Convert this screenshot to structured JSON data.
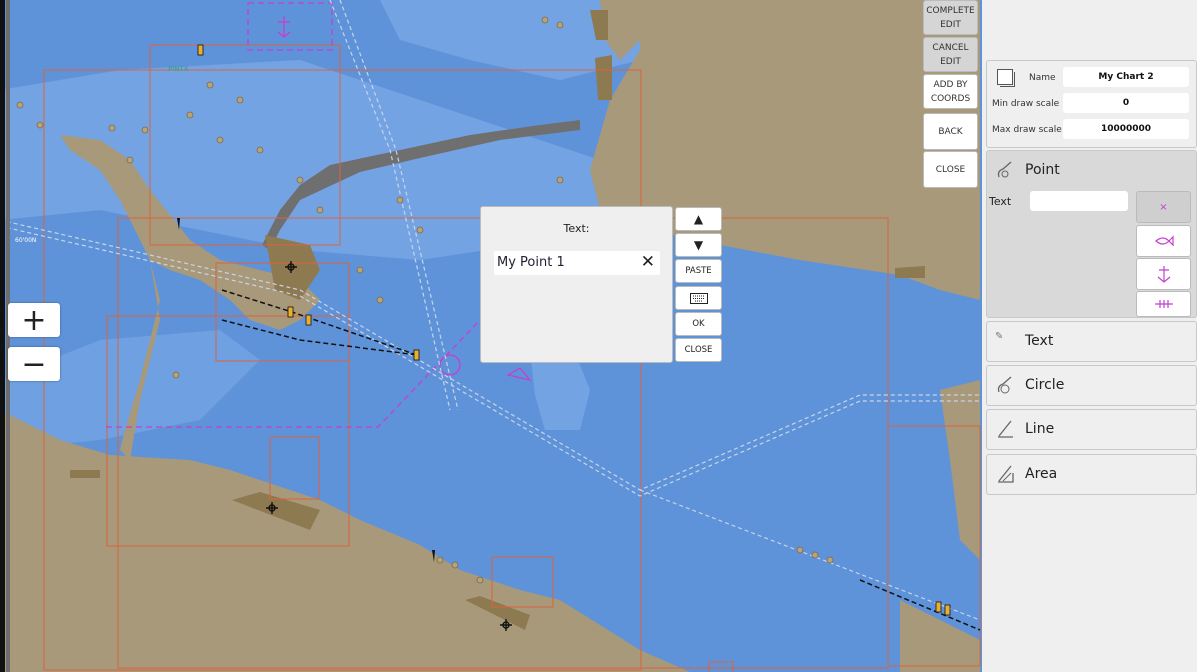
{
  "map": {
    "scale_label": "60'00N",
    "place_label": "PINTX"
  },
  "zoom": {
    "plus": "+",
    "minus": "−"
  },
  "toolbar": {
    "complete_edit": "COMPLETE\nEDIT",
    "cancel_edit": "CANCEL\nEDIT",
    "add_by_coords": "ADD BY\nCOORDS",
    "back": "BACK",
    "close": "CLOSE"
  },
  "chart_props": {
    "name_label": "Name",
    "name_value": "My Chart 2",
    "min_label": "Min draw scale",
    "min_value": "0",
    "max_label": "Max draw scale",
    "max_value": "10000000"
  },
  "tools": {
    "point": "Point",
    "point_text_label": "Text",
    "point_text_value": "",
    "text": "Text",
    "circle": "Circle",
    "line": "Line",
    "area": "Area"
  },
  "dialog": {
    "title": "Text:",
    "value": "My Point 1",
    "paste": "PASTE",
    "ok": "OK",
    "close": "CLOSE"
  },
  "colors": {
    "water_deep": "#5f93d9",
    "water_shallow": "#79a8e6",
    "land": "#a8997a",
    "accent_magenta": "#c43fcf"
  }
}
